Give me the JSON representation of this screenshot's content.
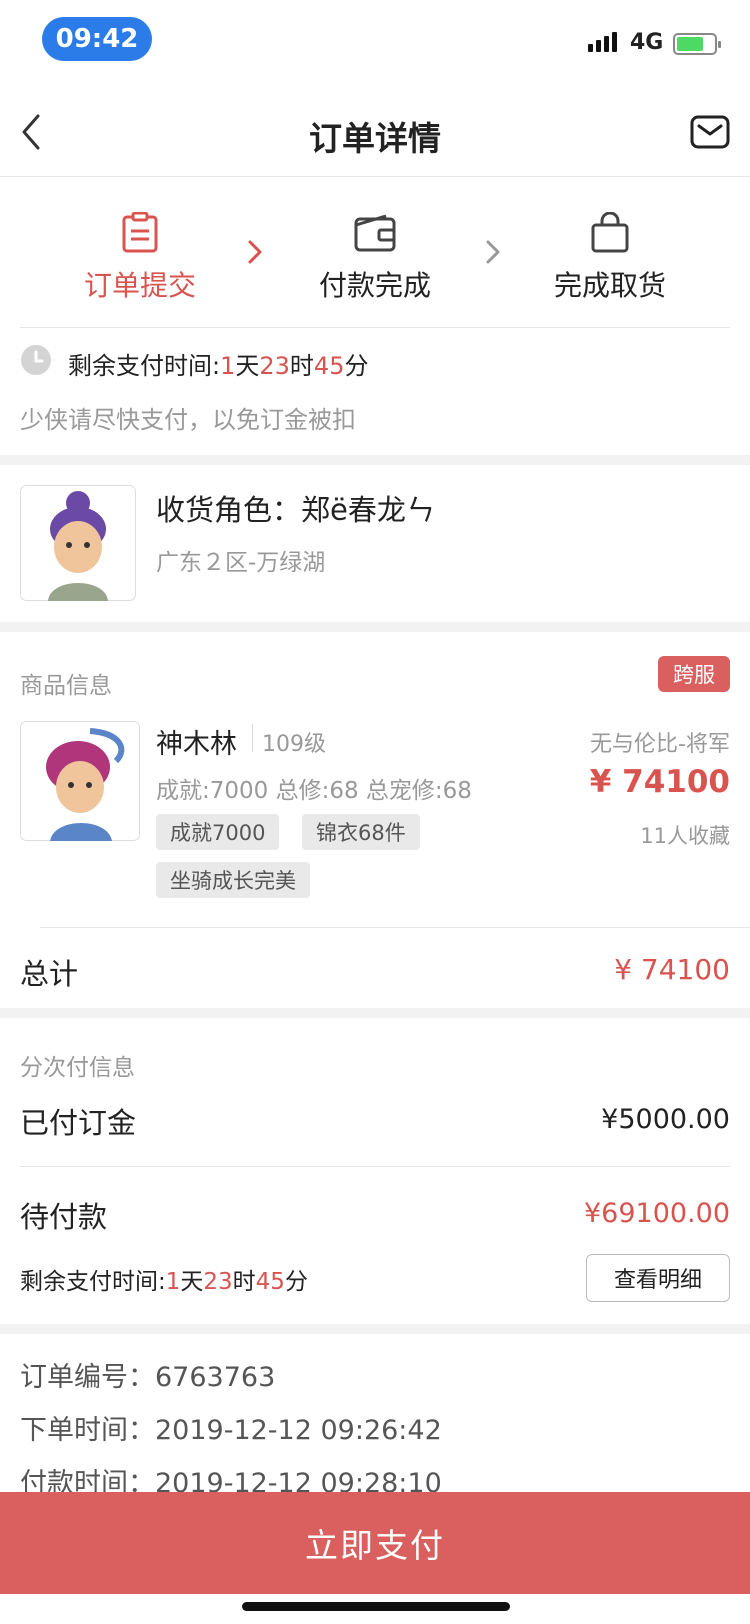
{
  "status_bar": {
    "time": "09:42",
    "network": "4G"
  },
  "header": {
    "title": "订单详情"
  },
  "steps": [
    {
      "label": "订单提交"
    },
    {
      "label": "付款完成"
    },
    {
      "label": "完成取货"
    }
  ],
  "countdown": {
    "label": "剩余支付时间:",
    "days": "1",
    "days_unit": "天",
    "hours": "23",
    "hours_unit": "时",
    "minutes": "45",
    "minutes_unit": "分"
  },
  "reminder": "少侠请尽快支付，以免订金被扣",
  "recipient": {
    "label": "收货角色：郑ë春龙ㄣ",
    "server": "广东２区-万绿湖"
  },
  "product": {
    "section_title": "商品信息",
    "badge": "跨服",
    "name": "神木林",
    "level": "109级",
    "stats": "成就:7000 总修:68 总宠修:68",
    "rank": "无与伦比-将军",
    "price": "¥ 74100",
    "favorites": "11人收藏",
    "tags": [
      "成就7000",
      "锦衣68件",
      "坐骑成长完美"
    ]
  },
  "total": {
    "label": "总计",
    "value": "¥ 74100"
  },
  "installment": {
    "section_title": "分次付信息",
    "paid_label": "已付订金",
    "paid_value": "¥5000.00",
    "pending_label": "待付款",
    "pending_value": "¥69100.00",
    "countdown_label": "剩余支付时间:",
    "days": "1",
    "days_unit": "天",
    "hours": "23",
    "hours_unit": "时",
    "minutes": "45",
    "minutes_unit": "分",
    "detail_button": "查看明细"
  },
  "order": {
    "number_label": "订单编号：",
    "number": "6763763",
    "created_label": "下单时间：",
    "created": "2019-12-12 09:26:42",
    "paid_label": "付款时间：",
    "paid": "2019-12-12 09:28:10"
  },
  "pay_button": "立即支付",
  "colors": {
    "accent": "#d9534f",
    "pay_bar": "#d9605e",
    "time_pill": "#2b7ce9"
  }
}
